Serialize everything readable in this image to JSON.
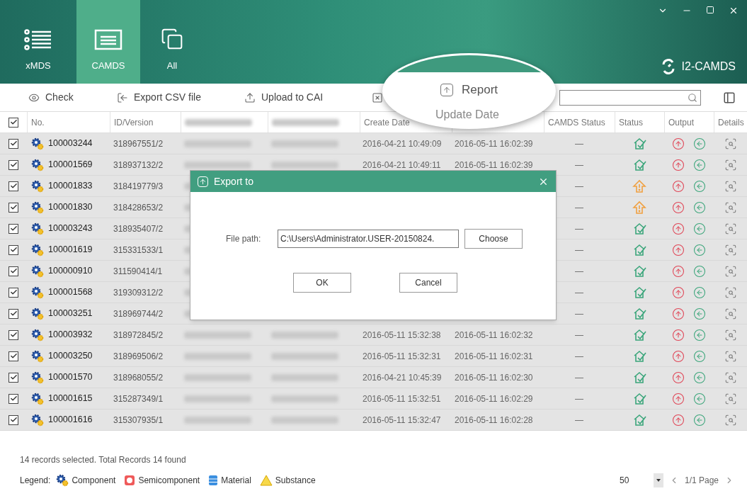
{
  "tabs": [
    {
      "label": "xMDS",
      "selected": false,
      "kind": "list"
    },
    {
      "label": "CAMDS",
      "selected": true,
      "kind": "form"
    },
    {
      "label": "All",
      "selected": false,
      "kind": "stack"
    }
  ],
  "app_name": "I2-CAMDS",
  "toolbar": [
    {
      "label": "Check",
      "kind": "eye"
    },
    {
      "label": "Export CSV file",
      "kind": "export"
    },
    {
      "label": "Upload to CAI",
      "kind": "upload"
    },
    {
      "kind": "clear"
    }
  ],
  "callout": {
    "button": "Report",
    "header": "Update Date"
  },
  "table": {
    "header_checked": true,
    "columns": [
      {
        "label": "No."
      },
      {
        "label": "ID/Version"
      },
      {
        "kind": "blurred"
      },
      {
        "kind": "blurred"
      },
      {
        "label": "Create Date"
      },
      {
        "kind": "callout"
      },
      {
        "label": "CAMDS Status"
      },
      {
        "label": "Status"
      },
      {
        "label": "Output"
      },
      {
        "label": "Details"
      }
    ],
    "rows": [
      {
        "checked": true,
        "no": "100003244",
        "id": "318967551/2",
        "create": "2016-04-21 10:49:09",
        "update": "2016-05-11 16:02:39",
        "camds_status": "—",
        "kind": "ok"
      },
      {
        "checked": true,
        "no": "100001569",
        "id": "318937132/2",
        "create": "2016-04-21 10:49:11",
        "update": "2016-05-11 16:02:39",
        "camds_status": "—",
        "kind": "ok"
      },
      {
        "checked": true,
        "no": "100001833",
        "id": "318419779/3",
        "camds_status": "—",
        "kind": "warning"
      },
      {
        "checked": true,
        "no": "100001830",
        "id": "318428653/2",
        "camds_status": "—",
        "kind": "warning"
      },
      {
        "checked": true,
        "no": "100003243",
        "id": "318935407/2",
        "camds_status": "—",
        "kind": "ok"
      },
      {
        "checked": true,
        "no": "100001619",
        "id": "315331533/1",
        "camds_status": "—",
        "kind": "ok"
      },
      {
        "checked": true,
        "no": "100000910",
        "id": "311590414/1",
        "camds_status": "—",
        "kind": "ok"
      },
      {
        "checked": true,
        "no": "100001568",
        "id": "319309312/2",
        "camds_status": "—",
        "kind": "ok"
      },
      {
        "checked": true,
        "no": "100003251",
        "id": "318969744/2",
        "camds_status": "—",
        "kind": "ok"
      },
      {
        "checked": true,
        "no": "100003932",
        "id": "318972845/2",
        "create": "2016-05-11 15:32:38",
        "update": "2016-05-11 16:02:32",
        "camds_status": "—",
        "kind": "ok"
      },
      {
        "checked": true,
        "no": "100003250",
        "id": "318969506/2",
        "create": "2016-05-11 15:32:31",
        "update": "2016-05-11 16:02:31",
        "camds_status": "—",
        "kind": "ok"
      },
      {
        "checked": true,
        "no": "100001570",
        "id": "318968055/2",
        "create": "2016-04-21 10:45:39",
        "update": "2016-05-11 16:02:30",
        "camds_status": "—",
        "kind": "ok"
      },
      {
        "checked": true,
        "no": "100001615",
        "id": "315287349/1",
        "create": "2016-05-11 15:32:51",
        "update": "2016-05-11 16:02:29",
        "camds_status": "—",
        "kind": "ok"
      },
      {
        "checked": true,
        "no": "100001616",
        "id": "315307935/1",
        "create": "2016-05-11 15:32:47",
        "update": "2016-05-11 16:02:28",
        "camds_status": "—",
        "kind": "ok"
      }
    ]
  },
  "footer": {
    "summary": "14 records selected. Total Records 14 found",
    "legend_label": "Legend:",
    "legend": [
      {
        "label": "Component",
        "kind": "component"
      },
      {
        "label": "Semicomponent",
        "kind": "semicomponent"
      },
      {
        "label": "Material",
        "kind": "material"
      },
      {
        "label": "Substance",
        "kind": "substance"
      }
    ],
    "page_size": "50",
    "page": "1/1 Page"
  },
  "dialog": {
    "title": "Export to",
    "field_label": "File path:",
    "file_path": "C:\\Users\\Administrator.USER-20150824.",
    "choose": "Choose",
    "ok": "OK",
    "cancel": "Cancel"
  }
}
